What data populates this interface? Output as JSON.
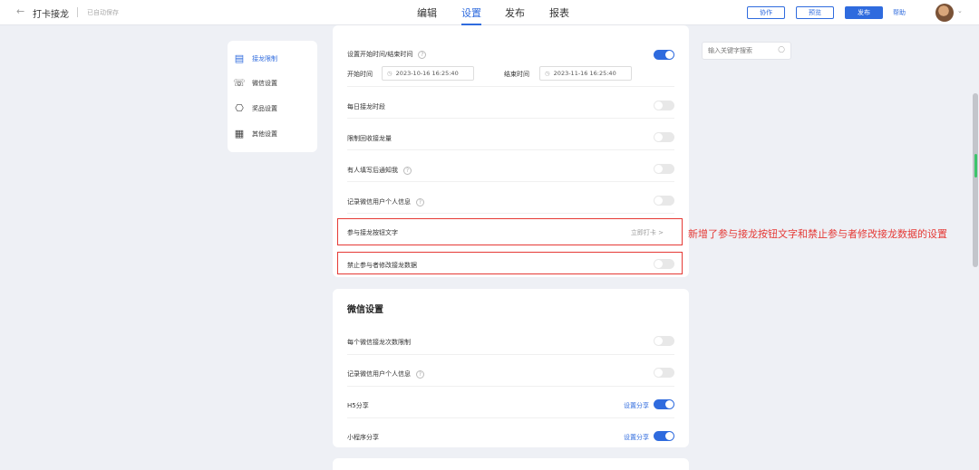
{
  "header": {
    "back_icon": "←",
    "title": "打卡接龙",
    "autosave": "已自动保存",
    "tabs": [
      "编辑",
      "设置",
      "发布",
      "报表"
    ],
    "active_tab": "设置",
    "collab_label": "协作",
    "preview_label": "预览",
    "publish_label": "发布",
    "help_label": "帮助",
    "caret": "⌄"
  },
  "sidebar": {
    "items": [
      {
        "label": "接龙限制",
        "icon": "list-icon",
        "glyph": "▤"
      },
      {
        "label": "微信设置",
        "icon": "wechat-icon",
        "glyph": "☏"
      },
      {
        "label": "奖品设置",
        "icon": "gift-icon",
        "glyph": "⎔"
      },
      {
        "label": "其他设置",
        "icon": "grid-icon",
        "glyph": "▦"
      }
    ]
  },
  "limits": {
    "time_setting_label": "设置开始时间/结束时间",
    "start_label": "开始时间",
    "start_value": "2023-10-16 16:25:40",
    "end_label": "结束时间",
    "end_value": "2023-11-16 16:25:40",
    "daily_period_label": "每日接龙时段",
    "limit_count_label": "限制回收接龙量",
    "notify_label": "有人填写后通知我",
    "record_info_label": "记录微信用户个人信息",
    "button_text_label": "参与接龙按钮文字",
    "button_text_value": "立即打卡 >",
    "forbid_edit_label": "禁止参与者修改接龙数据"
  },
  "annotation": "新增了参与接龙按钮文字和禁止参与者修改接龙数据的设置",
  "wechat": {
    "title": "微信设置",
    "per_user_limit_label": "每个微信接龙次数限制",
    "record_info_label": "记录微信用户个人信息",
    "h5_share_label": "H5分享",
    "h5_share_link": "设置分享",
    "mini_share_label": "小程序分享",
    "mini_share_link": "设置分享"
  },
  "search": {
    "placeholder": "输入关键字搜索",
    "icon": "○"
  },
  "qmark": "?",
  "clock_glyph": "◷",
  "colors": {
    "accent": "#2f6bde",
    "highlight": "#e53935",
    "background": "#eef0f5"
  }
}
